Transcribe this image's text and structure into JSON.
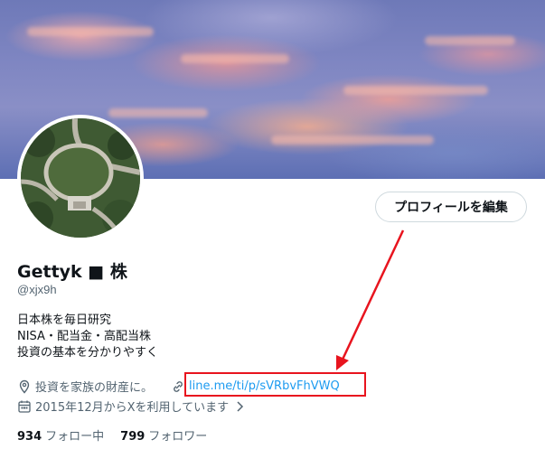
{
  "profile": {
    "edit_button": "プロフィールを編集",
    "display_name": "Gettyk ■ 株",
    "handle": "@xjx9h",
    "bio": [
      "日本株を毎日研究",
      "NISA・配当金・高配当株",
      "投資の基本を分かりやすく"
    ],
    "location": "投資を家族の財産に。",
    "link": "line.me/ti/p/sVRbvFhVWQ",
    "joined": "2015年12月からXを利用しています",
    "following_count": "934",
    "following_label": "フォロー中",
    "followers_count": "799",
    "followers_label": "フォロワー"
  },
  "icons": {
    "location": "location-pin-icon",
    "link": "link-icon",
    "calendar": "calendar-icon",
    "chevron": "chevron-right-icon"
  },
  "colors": {
    "link": "#1d9bf0",
    "annotation": "#e8141e",
    "muted": "#536471"
  }
}
